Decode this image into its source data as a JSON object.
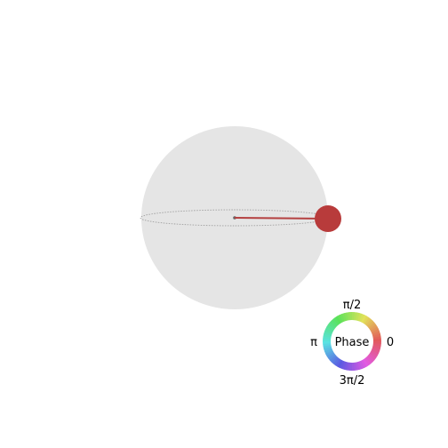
{
  "phase_wheel": {
    "center_label": "Phase",
    "label_top": "π/2",
    "label_left": "π",
    "label_right": "0",
    "label_bottom": "3π/2"
  },
  "colors": {
    "sphere_fill": "#e5e5e5",
    "equator_stroke": "#a0a0a0",
    "state_vector": "#b44040",
    "state_marker": "#b83b3b"
  },
  "state": {
    "phase_angle": 0
  }
}
